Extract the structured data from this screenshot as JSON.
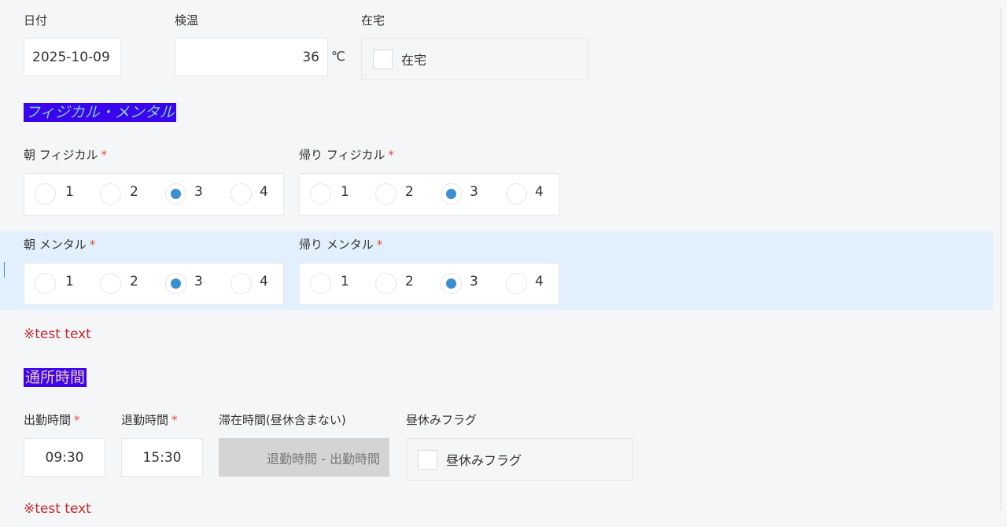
{
  "date": {
    "label": "日付",
    "value": "2025-10-09"
  },
  "temperature": {
    "label": "検温",
    "value": "36",
    "unit": "℃"
  },
  "at_home": {
    "label": "在宅",
    "checkbox_label": "在宅"
  },
  "section_physical_mental": "フィジカル・メンタル",
  "ratings": {
    "morning_physical": {
      "label": "朝 フィジカル",
      "required": "*",
      "options": [
        "1",
        "2",
        "3",
        "4"
      ],
      "selected": "3"
    },
    "return_physical": {
      "label": "帰り フィジカル",
      "required": "*",
      "options": [
        "1",
        "2",
        "3",
        "4"
      ],
      "selected": "3"
    },
    "morning_mental": {
      "label": "朝 メンタル",
      "required": "*",
      "options": [
        "1",
        "2",
        "3",
        "4"
      ],
      "selected": "3"
    },
    "return_mental": {
      "label": "帰り メンタル",
      "required": "*",
      "options": [
        "1",
        "2",
        "3",
        "4"
      ],
      "selected": "3"
    }
  },
  "note1": "※test text",
  "section_attendance": "通所時間",
  "attendance": {
    "start": {
      "label": "出勤時間",
      "required": "*",
      "value": "09:30"
    },
    "end": {
      "label": "退勤時間",
      "required": "*",
      "value": "15:30"
    },
    "stay": {
      "label": "滞在時間(昼休含まない)",
      "value": "退勤時間 - 出勤時間"
    },
    "lunch": {
      "label": "昼休みフラグ",
      "checkbox_label": "昼休みフラグ"
    }
  },
  "note2": "※test text",
  "colors": {
    "accent": "#3b8ed0",
    "section_bg": "#3a05ee",
    "required": "#e74c3c",
    "note": "#c1272d",
    "highlight": "#e1f0fc"
  }
}
